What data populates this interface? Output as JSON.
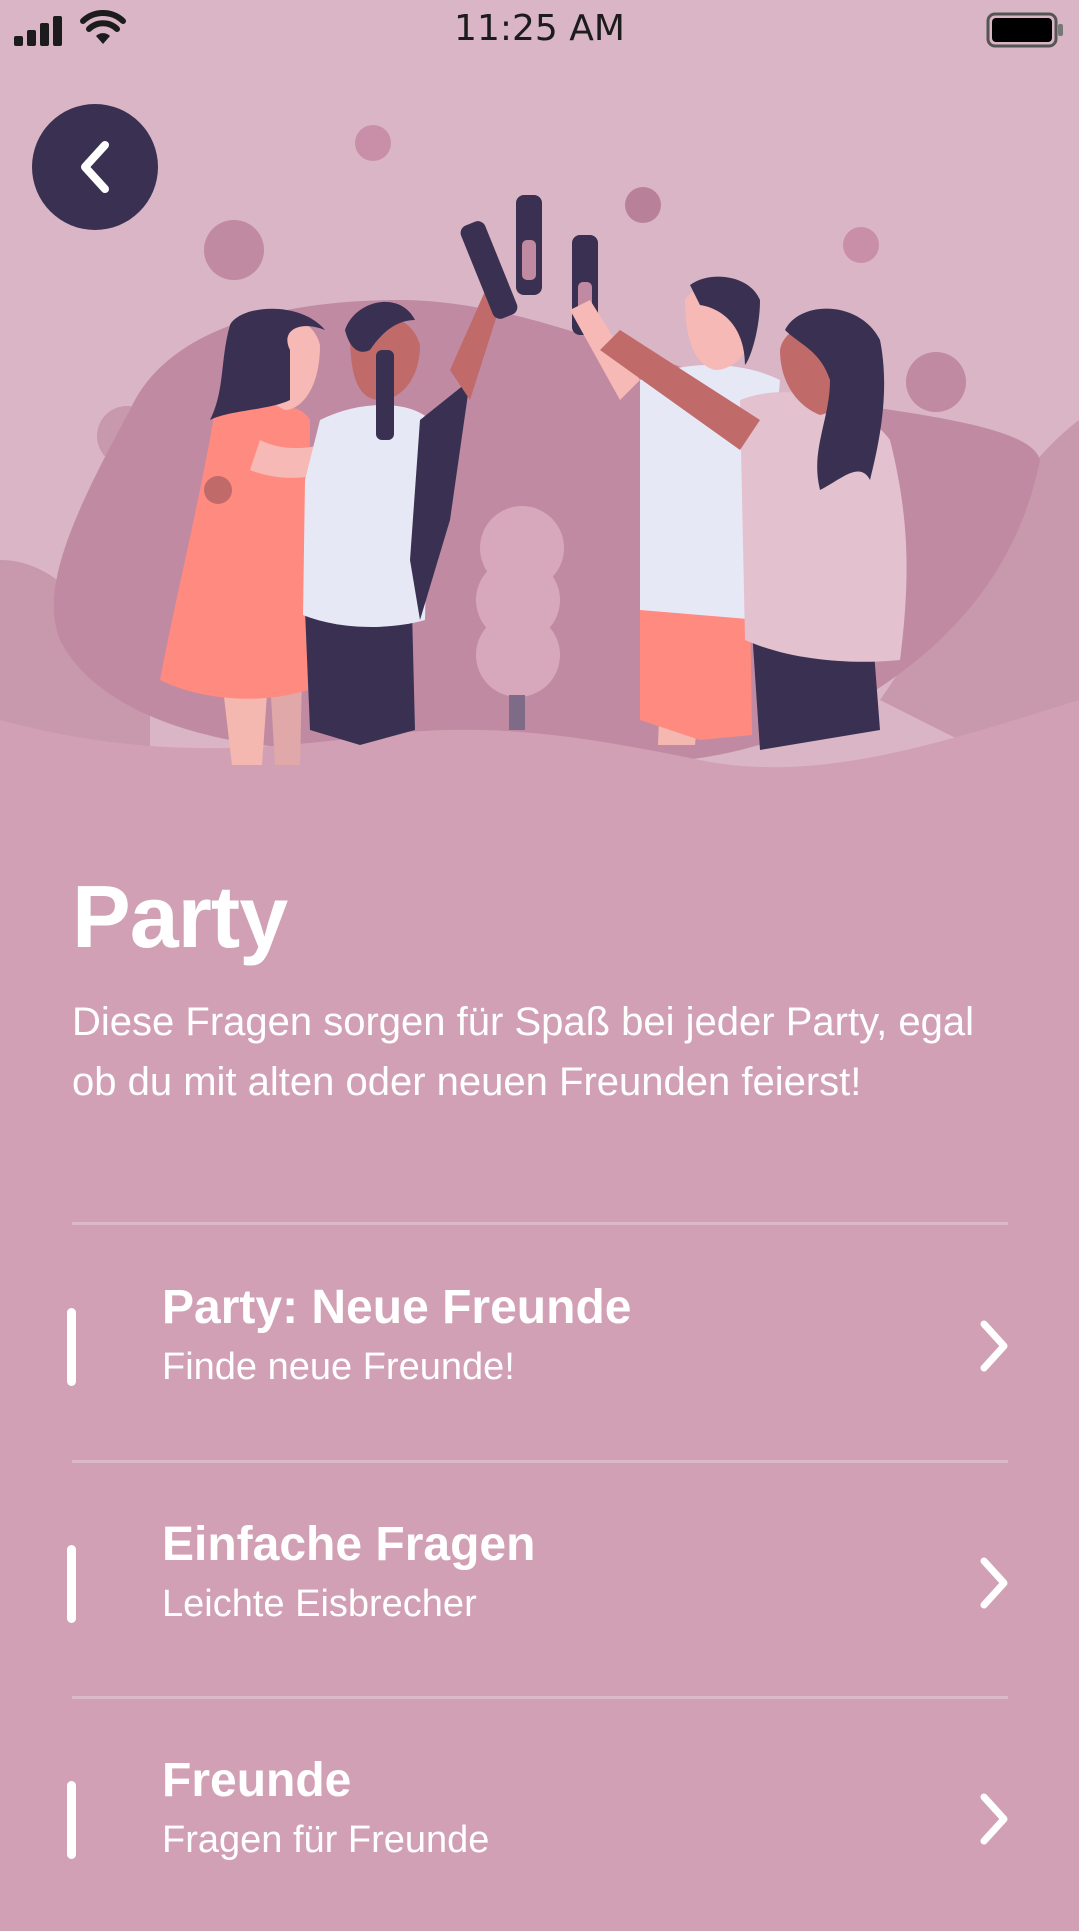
{
  "status_bar": {
    "time": "11:25 AM",
    "icons": [
      "signal-icon",
      "wifi-icon",
      "battery-icon"
    ]
  },
  "header": {
    "back_icon": "chevron-left-icon",
    "illustration": "party-people-toasting-illustration"
  },
  "main": {
    "title": "Party",
    "description": "Diese Fragen sorgen für Spaß bei jeder Party, egal ob du mit alten oder neuen Freunden feierst!"
  },
  "categories": [
    {
      "title": "Party: Neue Freunde",
      "subtitle": "Finde neue Freunde!"
    },
    {
      "title": "Einfache Fragen",
      "subtitle": "Leichte Eisbrecher"
    },
    {
      "title": "Freunde",
      "subtitle": "Fragen für Freunde"
    }
  ],
  "colors": {
    "background": "#d2a0b4",
    "status_bar": "#d9b5c5",
    "back_button": "#3a3152",
    "text": "#ffffff",
    "divider": "#dbb9c9"
  }
}
